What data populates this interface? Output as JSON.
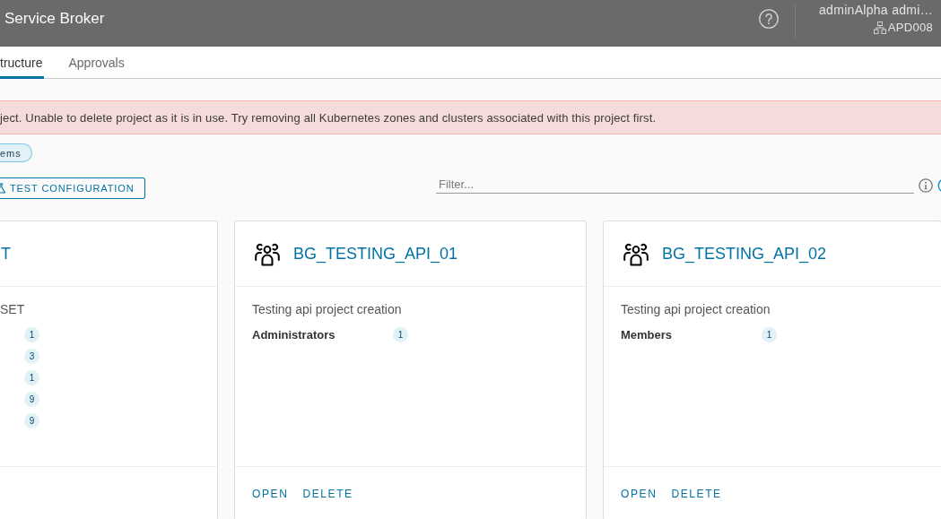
{
  "header": {
    "title": "Service Broker",
    "user": "adminAlpha admi…",
    "organization": "APD008"
  },
  "tabs": [
    {
      "label": "tructure",
      "selected": true
    },
    {
      "label": "Approvals",
      "selected": false
    }
  ],
  "alert": {
    "kind": "danger",
    "text": "ject. Unable to delete project as it is in use. Try removing all Kubernetes zones and clusters associated with this project first."
  },
  "chip": {
    "label": "ems"
  },
  "toolbar": {
    "button": {
      "label": "TEST CONFIGURATION"
    },
    "filter": {
      "placeholder": "Filter..."
    }
  },
  "cards": [
    {
      "kind": "cut",
      "title": "T",
      "description": "SET",
      "rows": [
        {
          "count": "1"
        },
        {
          "count": "3"
        },
        {
          "count": "1"
        },
        {
          "count": "9"
        },
        {
          "count": "9"
        }
      ]
    },
    {
      "kind": "whole",
      "title": "BG_TESTING_API_01",
      "description": "Testing api project creation",
      "rows": [
        {
          "label": "Administrators",
          "count": "1"
        }
      ],
      "actions": [
        "OPEN",
        "DELETE"
      ]
    },
    {
      "kind": "whole",
      "title": "BG_TESTING_API_02",
      "description": "Testing api project creation",
      "rows": [
        {
          "label": "Members",
          "count": "1"
        }
      ],
      "actions": [
        "OPEN",
        "DELETE"
      ]
    }
  ]
}
